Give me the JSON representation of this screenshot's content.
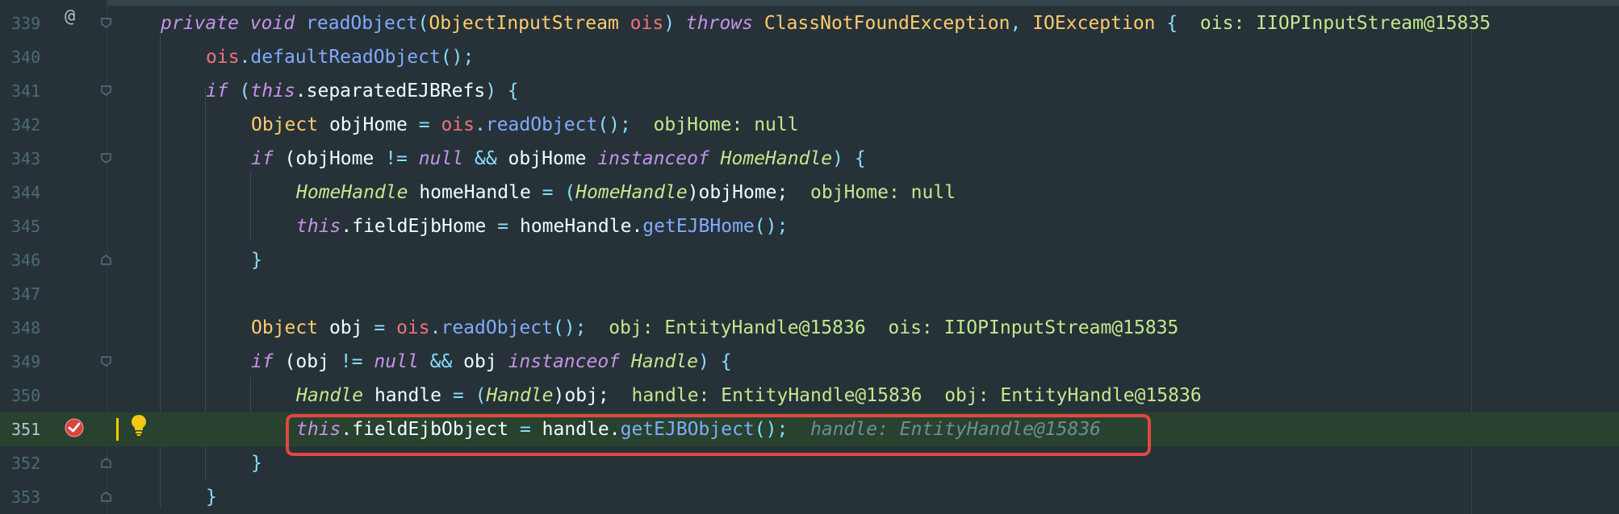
{
  "editor": {
    "lines": [
      {
        "number": "339",
        "seg": [
          "private",
          " ",
          "void",
          " ",
          "readObject",
          "(",
          "ObjectInputStream",
          " ",
          "ois",
          ") ",
          "throws",
          " ",
          "ClassNotFoundException",
          ", ",
          "IOException",
          " {",
          "  ois: IIOPInputStream@15835"
        ]
      },
      {
        "number": "340",
        "seg": [
          "ois",
          ".",
          "defaultReadObject",
          "();"
        ]
      },
      {
        "number": "341",
        "seg": [
          "if",
          " (",
          "this",
          ".separatedEJBRefs",
          ") {"
        ]
      },
      {
        "number": "342",
        "seg": [
          "Object",
          " objHome ",
          "=",
          " ",
          "ois",
          ".",
          "readObject",
          "();",
          "  objHome: null"
        ]
      },
      {
        "number": "343",
        "seg": [
          "if",
          " (objHome ",
          "!=",
          " ",
          "null",
          " ",
          "&&",
          " objHome ",
          "instanceof",
          " ",
          "HomeHandle",
          ") {"
        ]
      },
      {
        "number": "344",
        "seg": [
          "HomeHandle",
          " homeHandle ",
          "=",
          " (",
          "HomeHandle",
          ")objHome;",
          "  objHome: null"
        ]
      },
      {
        "number": "345",
        "seg": [
          "this",
          ".fieldEjbHome ",
          "=",
          " homeHandle.",
          "getEJBHome",
          "();"
        ]
      },
      {
        "number": "346",
        "seg": [
          "}"
        ]
      },
      {
        "number": "347",
        "seg": []
      },
      {
        "number": "348",
        "seg": [
          "Object",
          " obj ",
          "=",
          " ",
          "ois",
          ".",
          "readObject",
          "();",
          "  obj: EntityHandle@15836  ois: IIOPInputStream@15835"
        ]
      },
      {
        "number": "349",
        "seg": [
          "if",
          " (obj ",
          "!=",
          " ",
          "null",
          " ",
          "&&",
          " obj ",
          "instanceof",
          " ",
          "Handle",
          ") {"
        ]
      },
      {
        "number": "350",
        "seg": [
          "Handle",
          " handle ",
          "=",
          " (",
          "Handle",
          ")obj;",
          "  handle: EntityHandle@15836  obj: EntityHandle@15836"
        ]
      },
      {
        "number": "351",
        "seg": [
          "this",
          ".fieldEjbObject ",
          "=",
          " handle.",
          "getEJBObject",
          "();",
          "  handle: EntityHandle@15836"
        ]
      },
      {
        "number": "352",
        "seg": [
          "}"
        ]
      },
      {
        "number": "353",
        "seg": [
          "}"
        ]
      }
    ],
    "gutter": {
      "override_marker": "@",
      "breakpoint_icon": "breakpoint-check-icon",
      "intention_icon": "lightbulb-icon"
    },
    "colors": {
      "background": "#263238",
      "current_line": "#28422f",
      "keyword": "#c792ea",
      "type": "#ffcb6b",
      "function": "#82aaff",
      "variable": "#f07178",
      "inline_hint": "#c3e88d",
      "highlight_box": "#e2473f"
    }
  }
}
